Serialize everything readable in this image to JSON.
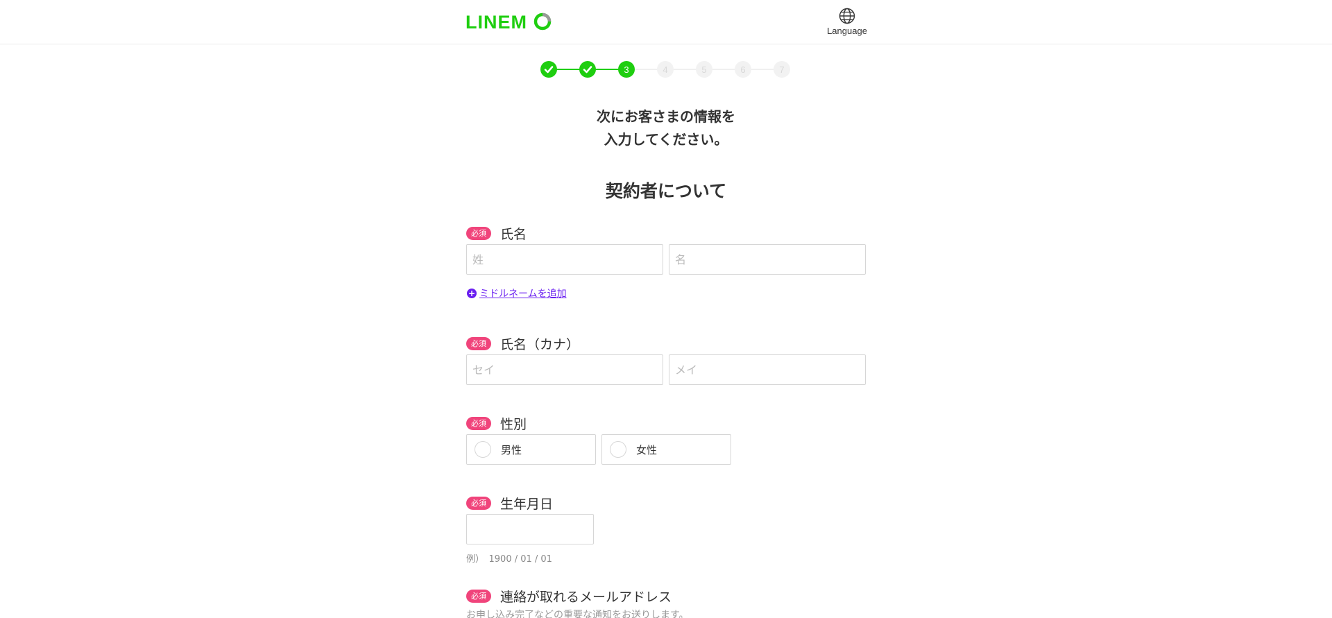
{
  "header": {
    "logo_text": "LINEMO",
    "language_label": "Language",
    "brand_color": "#1fce10"
  },
  "stepper": {
    "steps": [
      {
        "label": "1",
        "state": "done"
      },
      {
        "label": "2",
        "state": "done"
      },
      {
        "label": "3",
        "state": "current"
      },
      {
        "label": "4",
        "state": "todo"
      },
      {
        "label": "5",
        "state": "todo"
      },
      {
        "label": "6",
        "state": "todo"
      },
      {
        "label": "7",
        "state": "todo"
      }
    ]
  },
  "intro": {
    "line1": "次にお客さまの情報を",
    "line2": "入力してください。"
  },
  "section_title": "契約者について",
  "required_badge": "必須",
  "fields": {
    "name": {
      "label": "氏名",
      "last_placeholder": "姓",
      "first_placeholder": "名",
      "middle_name_link": "ミドルネームを追加"
    },
    "kana": {
      "label": "氏名（カナ）",
      "last_placeholder": "セイ",
      "first_placeholder": "メイ"
    },
    "gender": {
      "label": "性別",
      "options": [
        "男性",
        "女性"
      ]
    },
    "birthdate": {
      "label": "生年月日",
      "example": "例）　1900 / 01 / 01"
    },
    "email": {
      "label": "連絡が取れるメールアドレス",
      "note": "お申し込み完了などの重要な通知をお送りします。"
    }
  },
  "colors": {
    "required_badge": "#f0447b",
    "link": "#6a1ff0"
  }
}
